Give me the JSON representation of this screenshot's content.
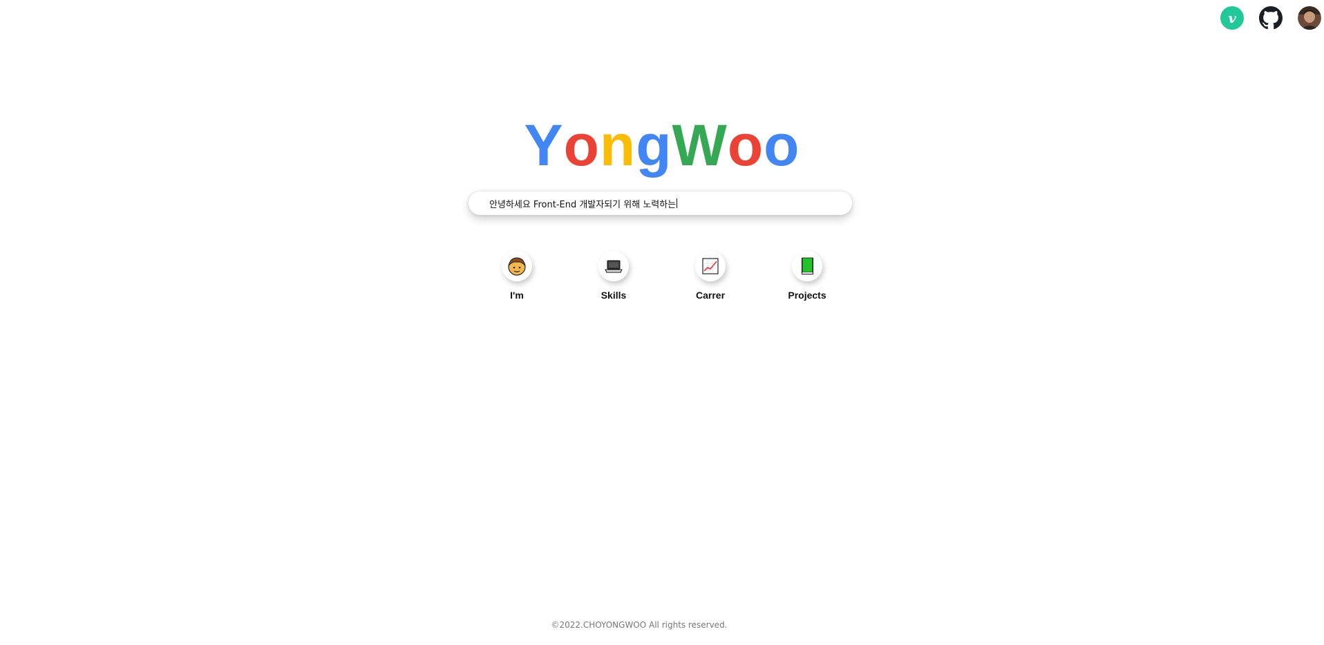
{
  "header": {
    "links": [
      {
        "name": "velog",
        "glyph": "v",
        "color": "#20c997"
      },
      {
        "name": "github"
      },
      {
        "name": "profile"
      }
    ]
  },
  "logo": {
    "letters": [
      {
        "char": "Y",
        "color": "#4285f4"
      },
      {
        "char": "o",
        "color": "#ea4335"
      },
      {
        "char": "n",
        "color": "#fbbc05"
      },
      {
        "char": "g",
        "color": "#4285f4"
      },
      {
        "char": "W",
        "color": "#34a853"
      },
      {
        "char": "o",
        "color": "#ea4335"
      },
      {
        "char": "o",
        "color": "#4285f4"
      }
    ]
  },
  "search": {
    "typed_text": "안녕하세요 Front-End 개발자되기 위해 노력하는"
  },
  "menu": {
    "items": [
      {
        "label": "I'm",
        "icon": "boy-face-icon"
      },
      {
        "label": "Skills",
        "icon": "laptop-icon"
      },
      {
        "label": "Carrer",
        "icon": "chart-increasing-icon"
      },
      {
        "label": "Projects",
        "icon": "green-book-icon"
      }
    ]
  },
  "footer": {
    "copyright": "©2022.CHOYONGWOO All rights reserved."
  }
}
